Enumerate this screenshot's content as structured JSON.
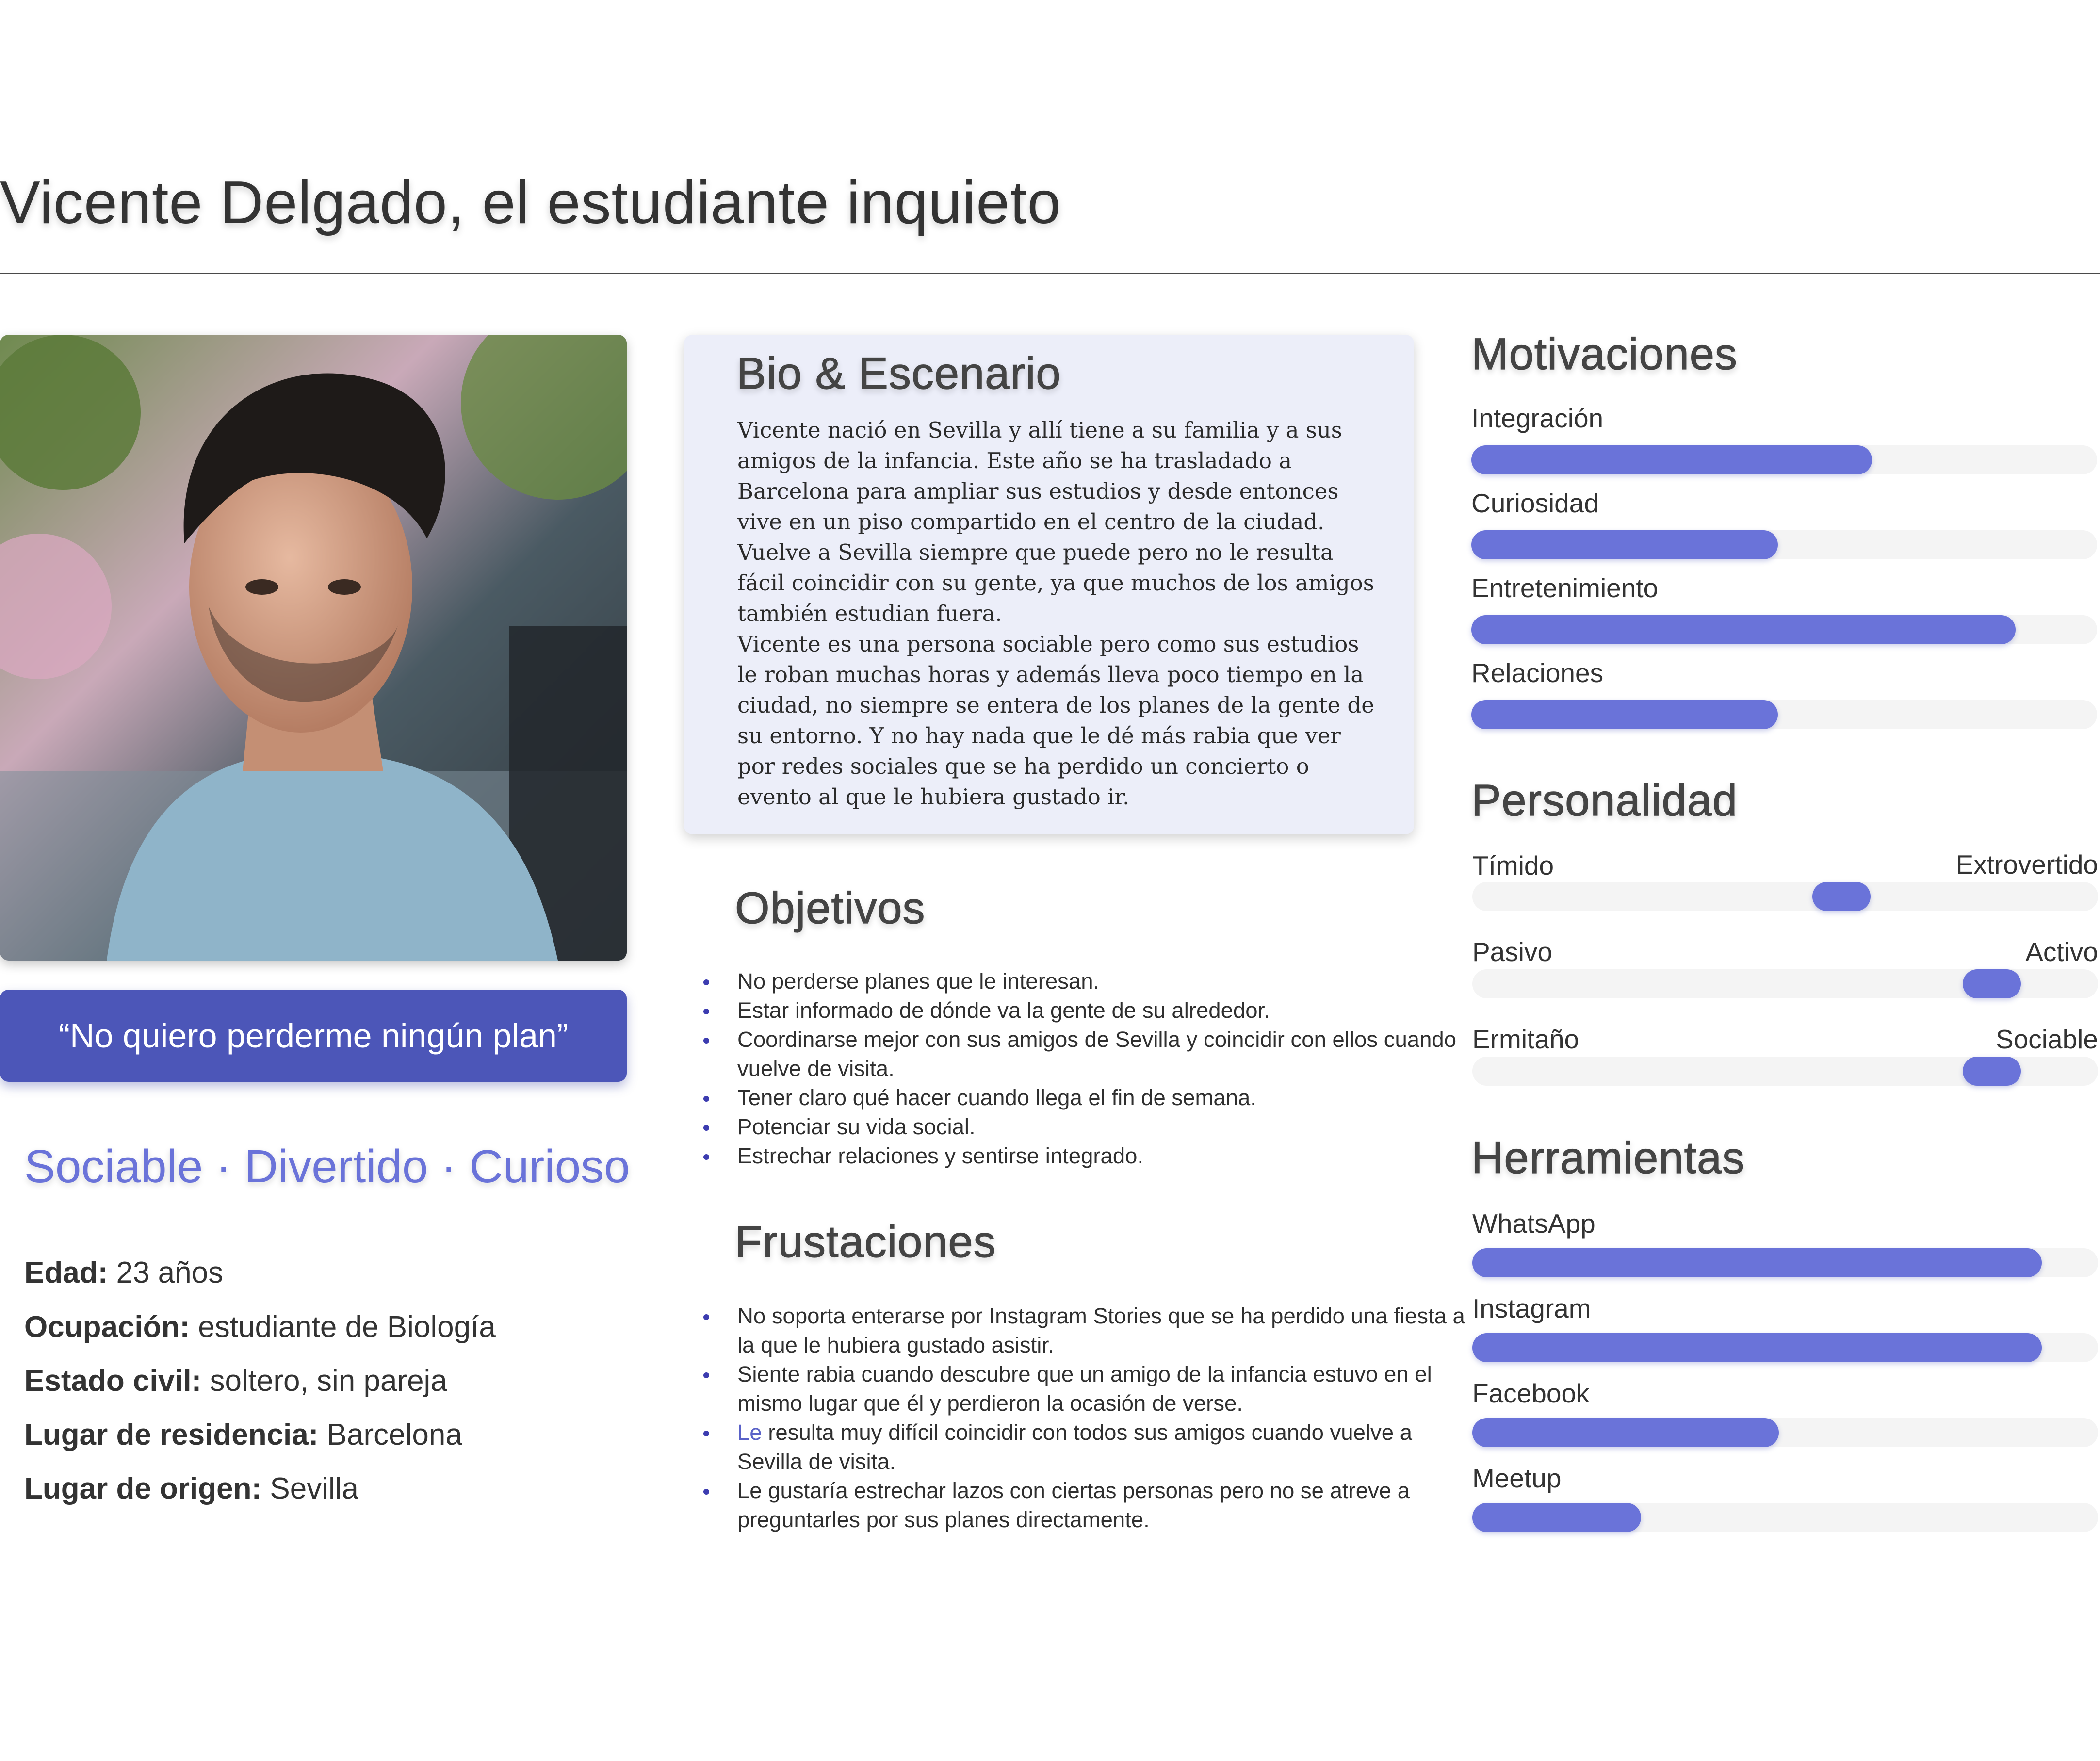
{
  "page": {
    "title": "Vicente Delgado, el estudiante inquieto",
    "quote": "“No quiero perderme ningún plan”",
    "traits": "Sociable · Divertido · Curioso"
  },
  "profile": [
    {
      "label": "Edad:",
      "value": " 23 años"
    },
    {
      "label": "Ocupación:",
      "value": " estudiante de Biología"
    },
    {
      "label": "Estado civil:",
      "value": " soltero, sin pareja"
    },
    {
      "label": "Lugar de residencia:",
      "value": " Barcelona"
    },
    {
      "label": "Lugar de origen:",
      "value": " Sevilla"
    }
  ],
  "bio": {
    "heading": "Bio & Escenario",
    "paragraphs": [
      "Vicente nació en Sevilla y allí tiene a su familia y a sus amigos de la infancia. Este año se ha trasladado a Barcelona para ampliar sus estudios y desde entonces vive en un piso compartido en el centro de la ciudad. Vuelve a Sevilla siempre que puede pero no le resulta fácil coincidir con su gente, ya que muchos de los amigos también estudian fuera.",
      "Vicente es una persona sociable pero como sus estudios le roban muchas horas y además lleva poco tiempo en la ciudad, no siempre se entera de los planes de la gente de su entorno. Y no hay nada que le dé más rabia que ver por redes sociales que se ha perdido un concierto o evento al que le hubiera gustado ir."
    ]
  },
  "objectives": {
    "heading": "Objetivos",
    "items": [
      "No perderse planes que le interesan.",
      "Estar informado de dónde va la gente de su alrededor.",
      "Coordinarse mejor con sus amigos de Sevilla y coincidir con ellos cuando vuelve de visita.",
      "Tener claro qué hacer cuando llega el fin de semana.",
      "Potenciar su vida social.",
      "Estrechar relaciones y sentirse integrado."
    ]
  },
  "frustrations": {
    "heading": "Frustaciones",
    "items": [
      {
        "pre": "",
        "text": "No soporta enterarse por Instagram Stories que se ha perdido una fiesta a la que le hubiera gustado asistir."
      },
      {
        "pre": "",
        "text": "Siente rabia cuando descubre que un amigo de la infancia estuvo en el mismo lugar que él y perdieron la ocasión de verse."
      },
      {
        "pre": "Le",
        "text": " resulta muy difícil coincidir con todos sus amigos cuando vuelve a Sevilla de visita."
      },
      {
        "pre": "",
        "text": "Le gustaría estrechar lazos con ciertas personas pero no se atreve a preguntarles por sus planes directamente."
      }
    ]
  },
  "motivations": {
    "heading": "Motivaciones",
    "items": [
      {
        "label": "Integración",
        "value": 0.64
      },
      {
        "label": "Curiosidad",
        "value": 0.49
      },
      {
        "label": "Entretenimiento",
        "value": 0.87
      },
      {
        "label": "Relaciones",
        "value": 0.49
      }
    ]
  },
  "personality": {
    "heading": "Personalidad",
    "items": [
      {
        "left": "Tímido",
        "right": "Extrovertido",
        "value": 0.59
      },
      {
        "left": "Pasivo",
        "right": "Activo",
        "value": 0.83
      },
      {
        "left": "Ermitaño",
        "right": "Sociable",
        "value": 0.83
      }
    ]
  },
  "tools": {
    "heading": "Herramientas",
    "items": [
      {
        "label": "WhatsApp",
        "value": 0.91
      },
      {
        "label": "Instagram",
        "value": 0.91
      },
      {
        "label": "Facebook",
        "value": 0.49
      },
      {
        "label": "Meetup",
        "value": 0.27
      }
    ]
  },
  "colors": {
    "accent": "#6a73d9",
    "quote_bg": "#4c56b8",
    "card_bg": "#eceef9"
  }
}
